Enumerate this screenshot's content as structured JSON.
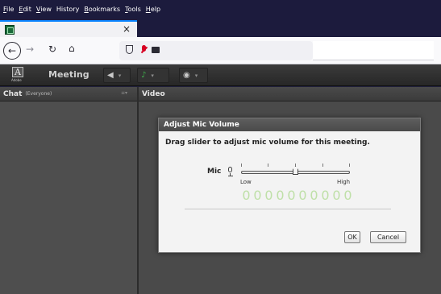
{
  "menubar": {
    "items": [
      {
        "acc": "F",
        "rest": "ile"
      },
      {
        "acc": "E",
        "rest": "dit"
      },
      {
        "acc": "V",
        "rest": "iew"
      },
      {
        "acc": "",
        "rest": "History"
      },
      {
        "acc": "B",
        "rest": "ookmarks"
      },
      {
        "acc": "T",
        "rest": "ools"
      },
      {
        "acc": "H",
        "rest": "elp"
      }
    ]
  },
  "tabstrip": {
    "tab_close": "×",
    "new_tab": "+"
  },
  "navbar": {
    "back": "←",
    "forward": "→",
    "reload": "↻",
    "home": "⌂"
  },
  "connect": {
    "logo_text": "Adobe",
    "title": "Meeting",
    "speaker_glyph": "◀",
    "mic_glyph": "♪",
    "camera_glyph": "◉",
    "caret": "▾"
  },
  "chat_pod": {
    "title": "Chat",
    "subtitle": "(Everyone)",
    "menu": "≡▾"
  },
  "video_pod": {
    "title": "Video"
  },
  "dialog": {
    "title": "Adjust Mic Volume",
    "message": "Drag slider to adjust mic volume for this meeting.",
    "mic_label": "Mic",
    "low_label": "Low",
    "high_label": "High",
    "level_meter": [
      "0",
      "0",
      "0",
      "0",
      "0",
      "0",
      "0",
      "0",
      "0",
      "0"
    ],
    "slider_value": 0.5,
    "ok_label": "OK",
    "cancel_label": "Cancel"
  },
  "colors": {
    "firefox_dark": "#1c1b3d",
    "connect_toolbar": "#2f2f2f",
    "mic_active": "#3fb04c",
    "level_meter": "#bfe0a8",
    "mic_blocked": "#d70022"
  }
}
